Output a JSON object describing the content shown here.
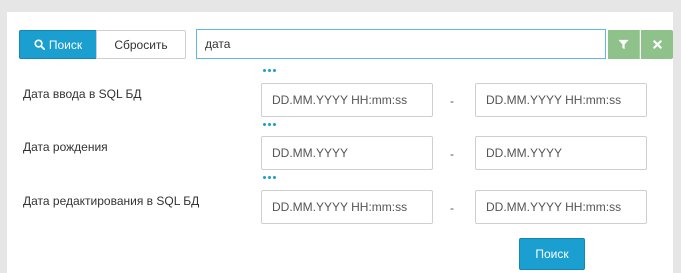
{
  "toolbar": {
    "search_label": "Поиск",
    "reset_label": "Сбросить",
    "query_value": "дата"
  },
  "fields": [
    {
      "label": "Дата ввода в SQL БД",
      "from_placeholder": "DD.MM.YYYY HH:mm:ss",
      "to_placeholder": "DD.MM.YYYY HH:mm:ss"
    },
    {
      "label": "Дата рождения",
      "from_placeholder": "DD.MM.YYYY",
      "to_placeholder": "DD.MM.YYYY"
    },
    {
      "label": "Дата редактирования в SQL БД",
      "from_placeholder": "DD.MM.YYYY HH:mm:ss",
      "to_placeholder": "DD.MM.YYYY HH:mm:ss"
    }
  ],
  "range_separator": "-",
  "submit_label": "Поиск",
  "colors": {
    "primary": "#1a9fd0",
    "filter_green": "#8fc18a",
    "input_focus": "#5fb8e0"
  }
}
